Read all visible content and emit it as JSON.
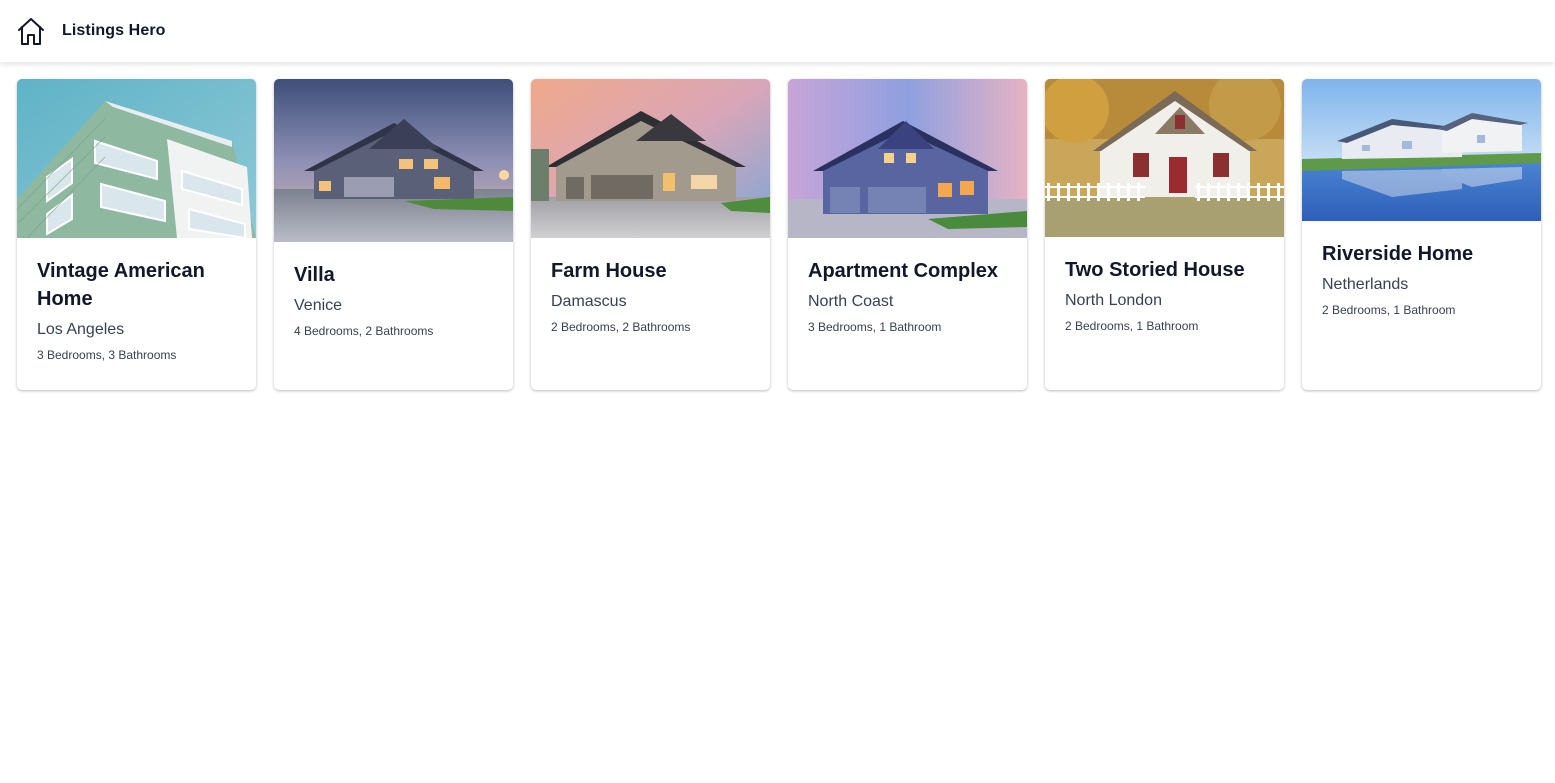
{
  "header": {
    "brand": "Listings Hero",
    "home_icon": "home-icon"
  },
  "listings": [
    {
      "title": "Vintage American Home",
      "location": "Los Angeles",
      "rooms": "3 Bedrooms, 3 Bathrooms",
      "photo": "apartment-building-photo"
    },
    {
      "title": "Villa",
      "location": "Venice",
      "rooms": "4 Bedrooms, 2 Bathrooms",
      "photo": "villa-photo"
    },
    {
      "title": "Farm House",
      "location": "Damascus",
      "rooms": "2 Bedrooms, 2 Bathrooms",
      "photo": "farm-house-photo"
    },
    {
      "title": "Apartment Complex",
      "location": "North Coast",
      "rooms": "3 Bedrooms, 1 Bathroom",
      "photo": "apartment-complex-photo"
    },
    {
      "title": "Two Storied House",
      "location": "North London",
      "rooms": "2 Bedrooms, 1 Bathroom",
      "photo": "two-storied-house-photo"
    },
    {
      "title": "Riverside Home",
      "location": "Netherlands",
      "rooms": "2 Bedrooms, 1 Bathroom",
      "photo": "riverside-home-photo"
    }
  ]
}
